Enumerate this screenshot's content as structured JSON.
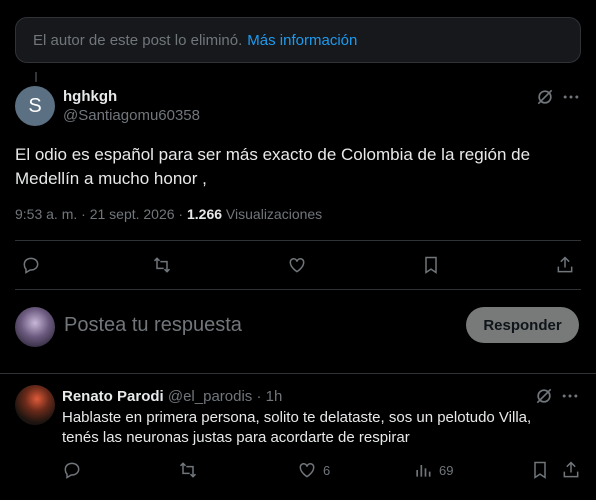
{
  "deleted_notice": {
    "text": "El autor de este post lo eliminó.",
    "link": "Más información"
  },
  "main_post": {
    "avatar_letter": "S",
    "name": "hghkgh",
    "handle": "@Santiagomu60358",
    "text": "El odio es español para ser más exacto de Colombia de la región de Medellín a mucho honor ,",
    "timestamp": "9:53 a. m. · 21 sept. 2026 · ",
    "views_count": "1.266",
    "views_label": " Visualizaciones"
  },
  "reply_composer": {
    "placeholder": "Postea tu respuesta",
    "button": "Responder"
  },
  "comment": {
    "name": "Renato Parodi",
    "handle": " @el_parodis · 1h",
    "text": "Hablaste en primera persona, solito te delataste, sos un pelotudo Villa, tenés las neuronas justas para acordarte de respirar",
    "likes": "6",
    "views": "69"
  },
  "colors": {
    "background": "#000000",
    "text": "#e7e9ea",
    "muted": "#71767b",
    "accent": "#1d9bf0",
    "border": "#2f3336"
  },
  "icons": [
    "grok-icon",
    "more-icon",
    "reply-icon",
    "retweet-icon",
    "like-icon",
    "bookmark-icon",
    "share-icon",
    "views-icon"
  ]
}
